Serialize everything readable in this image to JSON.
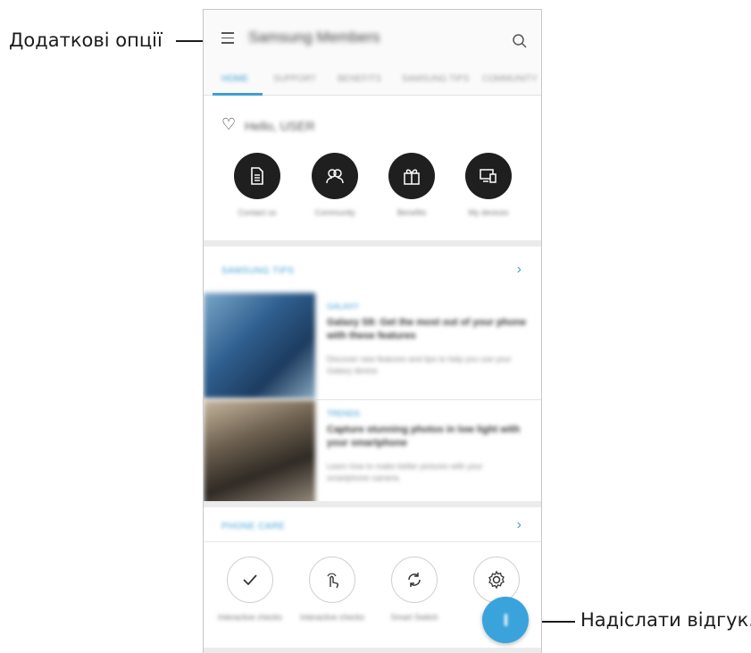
{
  "callouts": {
    "more_options": "Додаткові опції",
    "send_feedback": "Надіслати відгук."
  },
  "app": {
    "title": "Samsung Members",
    "tabs": [
      {
        "label": "HOME",
        "active": true
      },
      {
        "label": "SUPPORT",
        "active": false
      },
      {
        "label": "BENEFITS",
        "active": false
      },
      {
        "label": "SAMSUNG TIPS",
        "active": false
      },
      {
        "label": "COMMUNITY",
        "active": false
      }
    ],
    "greeting": "Hello, USER",
    "quick_actions": [
      {
        "label": "Contact us",
        "icon": "document-icon"
      },
      {
        "label": "Community",
        "icon": "people-icon"
      },
      {
        "label": "Benefits",
        "icon": "gift-icon"
      },
      {
        "label": "My devices",
        "icon": "devices-icon"
      }
    ],
    "tips_section": {
      "title": "SAMSUNG TIPS",
      "articles": [
        {
          "category": "GALAXY",
          "title": "Galaxy S8: Get the most out of your phone with these features",
          "description": "Discover new features and tips to help you use your Galaxy device."
        },
        {
          "category": "TRENDS",
          "title": "Capture stunning photos in low light with your smartphone",
          "description": "Learn how to make better pictures with your smartphone camera."
        }
      ]
    },
    "diagnostics_section": {
      "title": "PHONE CARE",
      "tools": [
        {
          "label": "Interactive checks",
          "icon": "check-icon"
        },
        {
          "label": "Interactive checks",
          "icon": "touch-icon"
        },
        {
          "label": "Smart Switch",
          "icon": "sync-icon"
        },
        {
          "label": "Settings",
          "icon": "settings-icon"
        }
      ]
    }
  },
  "colors": {
    "accent": "#3f9fd3",
    "fab": "#3aa3db",
    "dark_circle": "#1f1f1f"
  }
}
